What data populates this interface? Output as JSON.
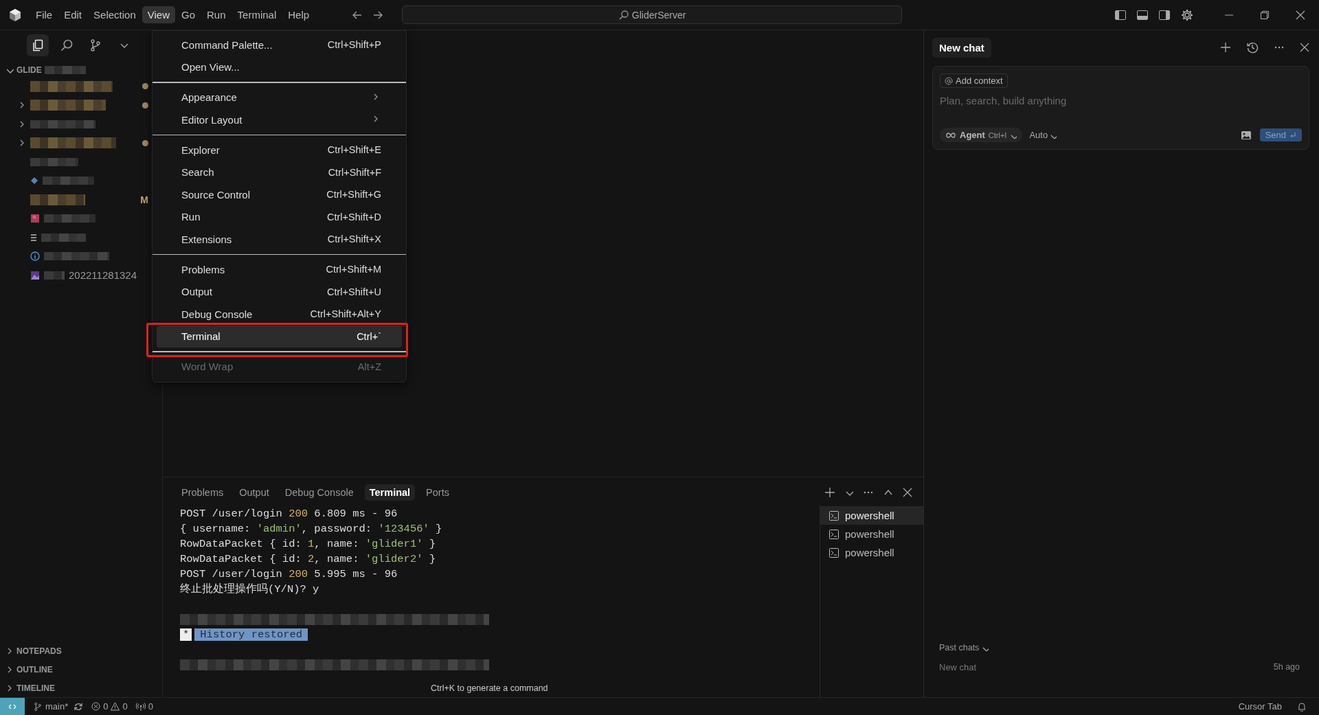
{
  "titlebar": {
    "menus": [
      {
        "label": "File",
        "selected": false
      },
      {
        "label": "Edit",
        "selected": false
      },
      {
        "label": "Selection",
        "selected": false
      },
      {
        "label": "View",
        "selected": true
      },
      {
        "label": "Go",
        "selected": false
      },
      {
        "label": "Run",
        "selected": false
      },
      {
        "label": "Terminal",
        "selected": false
      },
      {
        "label": "Help",
        "selected": false
      }
    ],
    "search": "GliderServer"
  },
  "view_menu": {
    "groups": [
      [
        {
          "label": "Command Palette...",
          "shortcut": "Ctrl+Shift+P",
          "submenu": false,
          "selected": false,
          "disabled": false
        },
        {
          "label": "Open View...",
          "submenu": false,
          "selected": false,
          "disabled": false
        }
      ],
      [
        {
          "label": "Appearance",
          "submenu": true,
          "selected": false,
          "disabled": false
        },
        {
          "label": "Editor Layout",
          "submenu": true,
          "selected": false,
          "disabled": false
        }
      ],
      [
        {
          "label": "Explorer",
          "shortcut": "Ctrl+Shift+E",
          "submenu": false,
          "selected": false,
          "disabled": false
        },
        {
          "label": "Search",
          "shortcut": "Ctrl+Shift+F",
          "submenu": false,
          "selected": false,
          "disabled": false
        },
        {
          "label": "Source Control",
          "shortcut": "Ctrl+Shift+G",
          "submenu": false,
          "selected": false,
          "disabled": false
        },
        {
          "label": "Run",
          "shortcut": "Ctrl+Shift+D",
          "submenu": false,
          "selected": false,
          "disabled": false
        },
        {
          "label": "Extensions",
          "shortcut": "Ctrl+Shift+X",
          "submenu": false,
          "selected": false,
          "disabled": false
        }
      ],
      [
        {
          "label": "Problems",
          "shortcut": "Ctrl+Shift+M",
          "submenu": false,
          "selected": false,
          "disabled": false
        },
        {
          "label": "Output",
          "shortcut": "Ctrl+Shift+U",
          "submenu": false,
          "selected": false,
          "disabled": false
        },
        {
          "label": "Debug Console",
          "shortcut": "Ctrl+Shift+Alt+Y",
          "submenu": false,
          "selected": false,
          "disabled": false
        },
        {
          "label": "Terminal",
          "shortcut": "Ctrl+`",
          "submenu": false,
          "selected": true,
          "disabled": false,
          "framed": true
        }
      ],
      [
        {
          "label": "Word Wrap",
          "shortcut": "Alt+Z",
          "submenu": false,
          "selected": false,
          "disabled": true
        }
      ]
    ]
  },
  "sidebar": {
    "tabs": [
      {
        "kind": "files",
        "selected": true
      },
      {
        "kind": "search",
        "selected": false
      },
      {
        "kind": "branch",
        "selected": false
      },
      {
        "kind": "more",
        "selected": false
      }
    ],
    "root": "GLIDE",
    "rows": [
      {
        "kind": "plain",
        "expandable": false,
        "modified": true
      },
      {
        "kind": "plain",
        "expandable": true,
        "modified": true
      },
      {
        "kind": "plain",
        "expandable": true,
        "modified": false
      },
      {
        "kind": "plain",
        "expandable": true,
        "modified": true
      },
      {
        "kind": "plain",
        "expandable": false,
        "modified": false
      },
      {
        "kind": "diamond",
        "expandable": false,
        "modified": false
      },
      {
        "kind": "plain",
        "expandable": false,
        "modified": false,
        "badge": "M"
      },
      {
        "kind": "image",
        "expandable": false,
        "modified": false
      },
      {
        "kind": "list",
        "expandable": false,
        "modified": false
      },
      {
        "kind": "info",
        "expandable": false,
        "modified": false
      },
      {
        "kind": "picture",
        "expandable": false,
        "modified": false,
        "text": "202211281324"
      }
    ],
    "sections": [
      {
        "label": "NOTEPADS",
        "expanded": false
      },
      {
        "label": "OUTLINE",
        "expanded": false
      },
      {
        "label": "TIMELINE",
        "expanded": false
      }
    ]
  },
  "panel": {
    "tabs": [
      {
        "label": "Problems",
        "selected": false
      },
      {
        "label": "Output",
        "selected": false
      },
      {
        "label": "Debug Console",
        "selected": false
      },
      {
        "label": "Terminal",
        "selected": true
      },
      {
        "label": "Ports",
        "selected": false
      }
    ],
    "lines": [
      [
        {
          "text": "POST /user/login ",
          "kind": "plain"
        },
        {
          "text": "200",
          "kind": "number"
        },
        {
          "text": " 6.809 ms - 96",
          "kind": "plain"
        }
      ],
      [
        {
          "text": "{ username: ",
          "kind": "plain"
        },
        {
          "text": "'admin'",
          "kind": "string"
        },
        {
          "text": ", password: ",
          "kind": "plain"
        },
        {
          "text": "'123456'",
          "kind": "string"
        },
        {
          "text": " }",
          "kind": "plain"
        }
      ],
      [
        {
          "text": "RowDataPacket { id: ",
          "kind": "plain"
        },
        {
          "text": "1",
          "kind": "number"
        },
        {
          "text": ", name: ",
          "kind": "plain"
        },
        {
          "text": "'glider1'",
          "kind": "string"
        },
        {
          "text": " }",
          "kind": "plain"
        }
      ],
      [
        {
          "text": "RowDataPacket { id: ",
          "kind": "plain"
        },
        {
          "text": "2",
          "kind": "number"
        },
        {
          "text": ", name: ",
          "kind": "plain"
        },
        {
          "text": "'glider2'",
          "kind": "string"
        },
        {
          "text": " }",
          "kind": "plain"
        }
      ],
      [
        {
          "text": "POST /user/login ",
          "kind": "plain"
        },
        {
          "text": "200",
          "kind": "number"
        },
        {
          "text": " 5.995 ms - 96",
          "kind": "plain"
        }
      ],
      [
        {
          "text": "终止批处理操作吗(Y/N)? y",
          "kind": "plain"
        }
      ],
      [
        {
          "kind": "blank"
        }
      ],
      [
        {
          "kind": "redacted"
        }
      ],
      [
        {
          "text": "*",
          "kind": "inverse"
        },
        {
          "text": "History restored",
          "kind": "highlight"
        }
      ],
      [
        {
          "kind": "blank"
        }
      ],
      [
        {
          "kind": "redacted"
        }
      ]
    ],
    "hint": "Ctrl+K to generate a command",
    "terminals": [
      {
        "label": "powershell",
        "selected": true
      },
      {
        "label": "powershell",
        "selected": false
      },
      {
        "label": "powershell",
        "selected": false
      }
    ]
  },
  "chat": {
    "tab": "New chat",
    "add_context": "Add context",
    "placeholder": "Plan, search, build anything",
    "mode": "Agent",
    "mode_shortcut": "Ctrl+I",
    "model": "Auto",
    "send": "Send",
    "past_label": "Past chats",
    "past": [
      {
        "title": "New chat",
        "time": "5h ago"
      }
    ]
  },
  "status_bar": {
    "branch": "main*",
    "errors": "0",
    "warnings": "0",
    "ports": "0",
    "cursor_tab": "Cursor Tab"
  }
}
